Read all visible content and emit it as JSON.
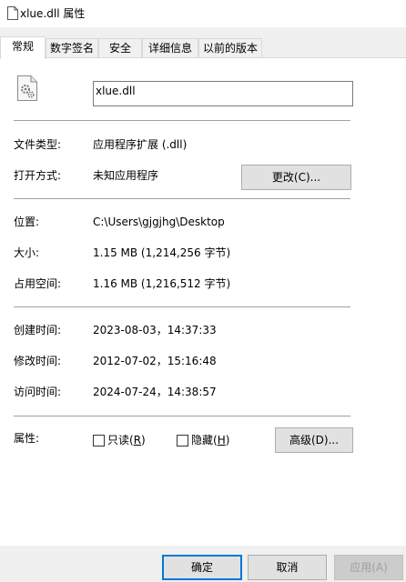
{
  "window": {
    "title": "xlue.dll 属性",
    "icon": "file-icon"
  },
  "tabs": [
    {
      "label": "常规",
      "active": true
    },
    {
      "label": "数字签名",
      "active": false
    },
    {
      "label": "安全",
      "active": false
    },
    {
      "label": "详细信息",
      "active": false
    },
    {
      "label": "以前的版本",
      "active": false
    }
  ],
  "general": {
    "file_icon": "dll-gear-file-icon",
    "filename": "xlue.dll",
    "type_label": "文件类型:",
    "type_value": "应用程序扩展 (.dll)",
    "opens_with_label": "打开方式:",
    "opens_with_value": "未知应用程序",
    "change_button": "更改(C)...",
    "location_label": "位置:",
    "location_value": "C:\\Users\\gjgjhg\\Desktop",
    "size_label": "大小:",
    "size_value": "1.15 MB (1,214,256 字节)",
    "size_on_disk_label": "占用空间:",
    "size_on_disk_value": "1.16 MB (1,216,512 字节)",
    "created_label": "创建时间:",
    "created_value": "2023-08-03，14:37:33",
    "modified_label": "修改时间:",
    "modified_value": "2012-07-02，15:16:48",
    "accessed_label": "访问时间:",
    "accessed_value": "2024-07-24，14:38:57",
    "attributes_label": "属性:",
    "readonly_prefix": "只读(",
    "readonly_key": "R",
    "readonly_suffix": ")",
    "hidden_prefix": "隐藏(",
    "hidden_key": "H",
    "hidden_suffix": ")",
    "advanced_button": "高级(D)..."
  },
  "footer": {
    "ok": "确定",
    "cancel": "取消",
    "apply": "应用(A)"
  }
}
